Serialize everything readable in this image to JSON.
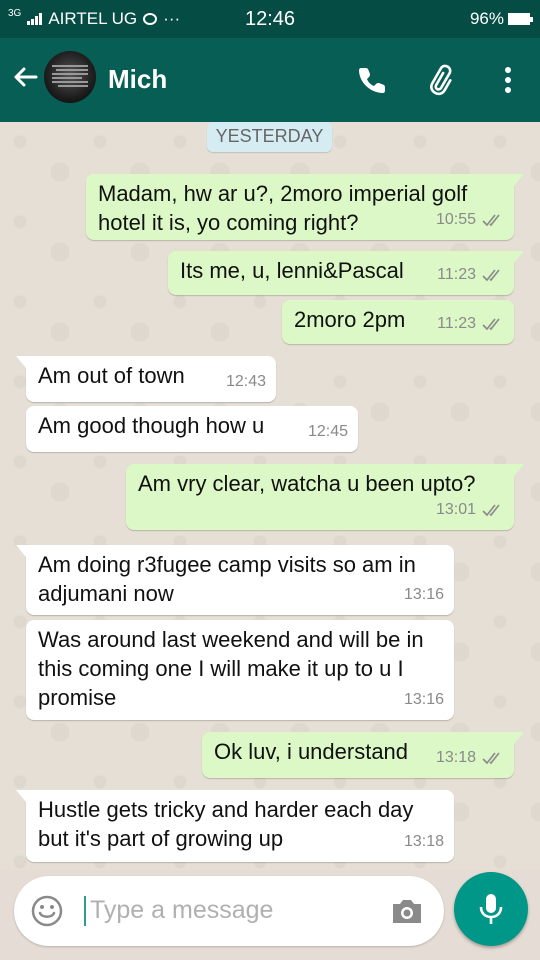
{
  "status": {
    "network": "3G",
    "carrier": "AIRTEL UG",
    "dots": "···",
    "time": "12:46",
    "battery": "96%"
  },
  "header": {
    "contact_name": "Mich",
    "icons": [
      "back-arrow-icon",
      "call-icon",
      "attach-icon",
      "more-vert-icon"
    ]
  },
  "date_chip": "YESTERDAY",
  "messages": [
    {
      "dir": "out",
      "text": "Madam, hw ar u?, 2moro imperial golf hotel it is, yo coming right?",
      "time": "10:55",
      "ticks": "read"
    },
    {
      "dir": "out",
      "text": "Its me, u, lenni&Pascal",
      "time": "11:23",
      "ticks": "read"
    },
    {
      "dir": "out",
      "text": "2moro 2pm",
      "time": "11:23",
      "ticks": "read"
    },
    {
      "dir": "in",
      "text": "Am out of town",
      "time": "12:43"
    },
    {
      "dir": "in",
      "text": "Am good though how u",
      "time": "12:45"
    },
    {
      "dir": "out",
      "text": "Am vry clear, watcha u been upto?",
      "time": "13:01",
      "ticks": "read"
    },
    {
      "dir": "in",
      "text": "Am doing r3fugee camp visits so am in adjumani now",
      "time": "13:16"
    },
    {
      "dir": "in",
      "text": "Was around last weekend and will be in this coming one I will make it up to u I promise",
      "time": "13:16"
    },
    {
      "dir": "out",
      "text": "Ok luv, i understand",
      "time": "13:18",
      "ticks": "read"
    },
    {
      "dir": "in",
      "text": "Hustle gets tricky and harder each day but it's part of growing up",
      "time": "13:18"
    }
  ],
  "composer": {
    "placeholder": "Type a message"
  },
  "colors": {
    "header": "#075e54",
    "statusbar": "#054d44",
    "outgoing": "#dcf8c6",
    "incoming": "#ffffff",
    "fab": "#009688",
    "ticks": "#8a8a8a"
  }
}
